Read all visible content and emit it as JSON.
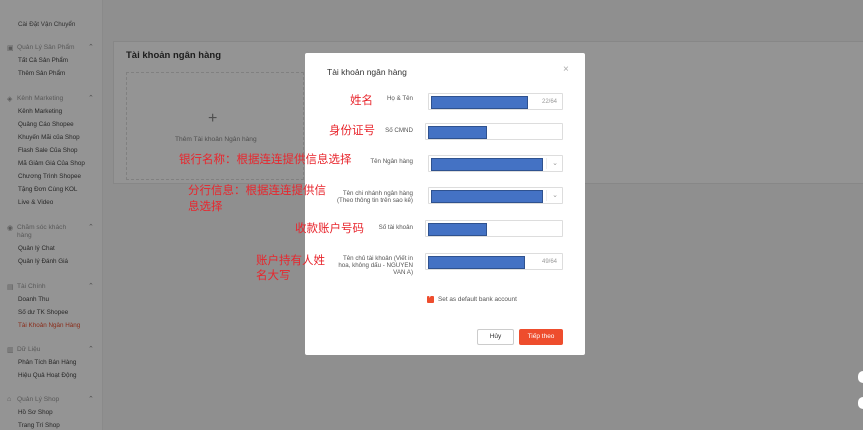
{
  "sidebar": {
    "top_item": "Cài Đặt Vận Chuyển",
    "sections": [
      {
        "title": "Quản Lý Sản Phẩm",
        "icon": "product-icon",
        "items": [
          "Tất Cả Sản Phẩm",
          "Thêm Sản Phẩm"
        ]
      },
      {
        "title": "Kênh Marketing",
        "icon": "marketing-icon",
        "items": [
          "Kênh Marketing",
          "Quảng Cáo Shopee",
          "Khuyến Mãi của Shop",
          "Flash Sale Của Shop",
          "Mã Giảm Giá Của Shop",
          "Chương Trình Shopee",
          "Tặng Đơn Cùng KOL",
          "Live & Video"
        ]
      },
      {
        "title": "Chăm sóc khách hàng",
        "icon": "customer-care-icon",
        "items": [
          "Quản lý Chat",
          "Quản lý Đánh Giá"
        ]
      },
      {
        "title": "Tài Chính",
        "icon": "finance-icon",
        "items": [
          "Doanh Thu",
          "Số dư TK Shopee",
          "Tài Khoản Ngân Hàng"
        ],
        "active_item": "Tài Khoản Ngân Hàng"
      },
      {
        "title": "Dữ Liệu",
        "icon": "data-icon",
        "items": [
          "Phân Tích Bán Hàng",
          "Hiệu Quả Hoạt Động"
        ]
      },
      {
        "title": "Quản Lý Shop",
        "icon": "shop-icon",
        "items": [
          "Hồ Sơ Shop",
          "Trang Trí Shop"
        ]
      }
    ]
  },
  "main": {
    "title": "Tài khoản ngân hàng",
    "add_label": "Thêm Tài khoản Ngân hàng",
    "add_symbol": "+"
  },
  "modal": {
    "title": "Tài khoản ngân hàng",
    "close_symbol": "×",
    "fields": {
      "name": {
        "label": "Họ & Tên",
        "counter": "22/64"
      },
      "id_number": {
        "label": "Số CMND"
      },
      "bank_name": {
        "label": "Tên Ngân hàng"
      },
      "branch": {
        "label": "Tên chi nhánh ngân hàng (Theo thông tin trên sao kê)"
      },
      "account_number": {
        "label": "Số tài khoản"
      },
      "holder_name": {
        "label": "Tên chủ tài khoản (Viết in hoa, không dấu - NGUYEN VAN A)",
        "counter": "49/64"
      }
    },
    "default_checkbox": {
      "label": "Set as default bank account",
      "checked": true
    },
    "cancel_label": "Hủy",
    "next_label": "Tiếp theo"
  },
  "annotations": {
    "name": "姓名",
    "id_number": "身份证号",
    "bank": "银行名称：根据连连提供信息选择",
    "branch_line1": "分行信息：根据连连提供信",
    "branch_line2": "息选择",
    "account": "收款账户号码",
    "holder_line1": "账户持有人姓",
    "holder_line2": "名大写"
  },
  "colors": {
    "accent": "#ee4d2d",
    "annotation": "#e8262d",
    "redaction": "#4472c4"
  }
}
